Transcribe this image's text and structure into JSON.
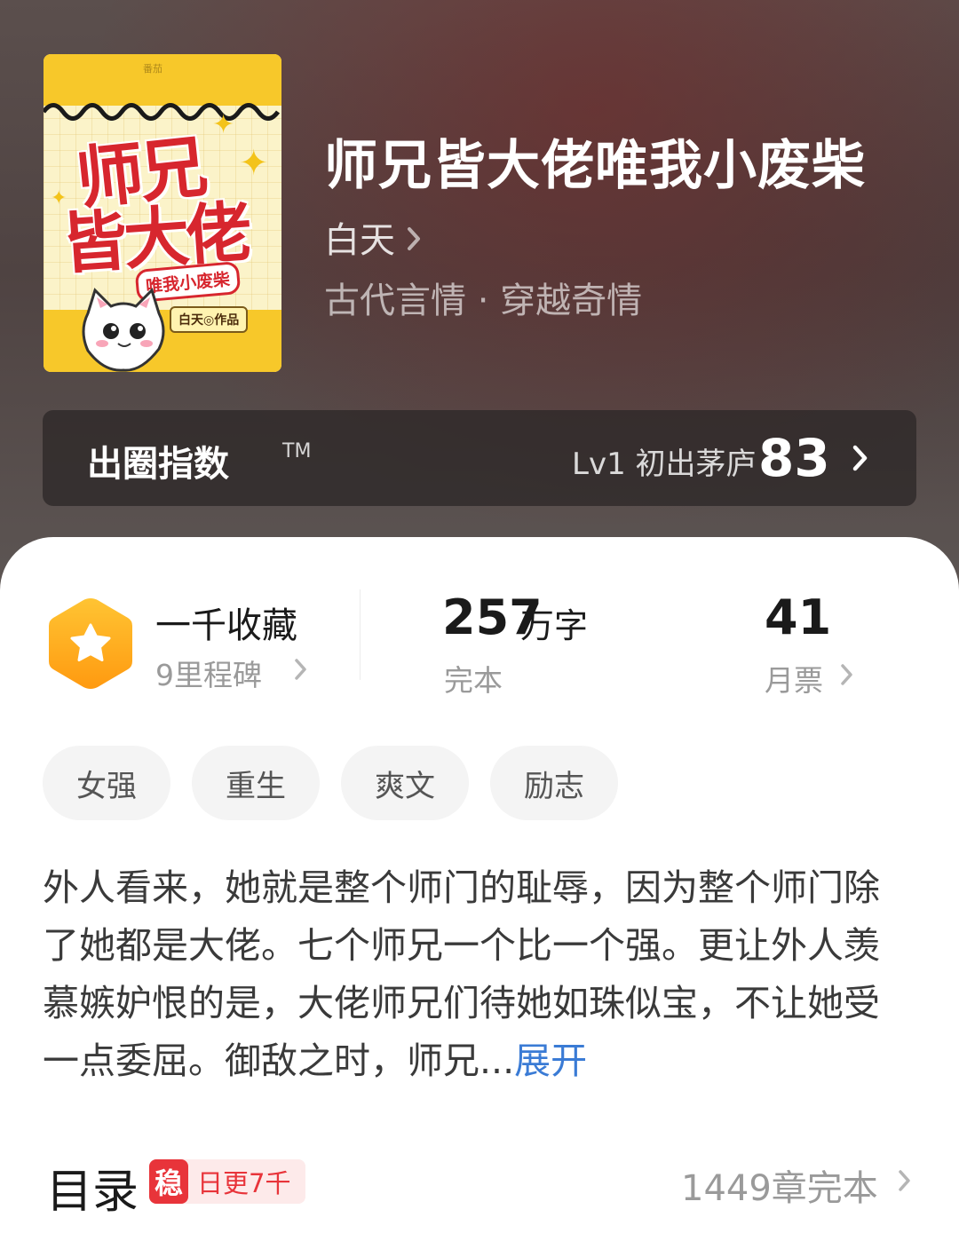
{
  "book": {
    "title": "师兄皆大佬唯我小废柴",
    "author": "白天",
    "genre": "古代言情 · 穿越奇情"
  },
  "cover": {
    "title_line1": "师兄",
    "title_line2": "皆大佬",
    "subtitle": "唯我小废柴",
    "author_credit": "白天◎作品",
    "brand": "番茄"
  },
  "influence_index": {
    "label": "出圈指数",
    "trademark": "TM",
    "level": "Lv1 初出茅庐",
    "score": "83"
  },
  "stats": {
    "favorites_title": "一千收藏",
    "favorites_sub": "9里程碑",
    "word_count": "257",
    "word_unit": "万字",
    "status": "完本",
    "monthly_tickets": "41",
    "monthly_tickets_label": "月票"
  },
  "tags": [
    "女强",
    "重生",
    "爽文",
    "励志"
  ],
  "synopsis": {
    "text": "外人看来，她就是整个师门的耻辱，因为整个师门除了她都是大佬。七个师兄一个比一个强。更让外人羡慕嫉妒恨的是，大佬师兄们待她如珠似宝，不让她受一点委屈。御敌之时，师兄...",
    "expand_label": "展开"
  },
  "toc": {
    "title": "目录",
    "badge_mark": "稳",
    "badge_text": "日更7千",
    "chapter_count": "1449章完本"
  },
  "colors": {
    "accent_blue": "#3a7bd5",
    "badge_red": "#e8343a",
    "badge_orange": "#ffb020",
    "cover_yellow": "#f7c82a",
    "cover_red": "#d7262e"
  }
}
